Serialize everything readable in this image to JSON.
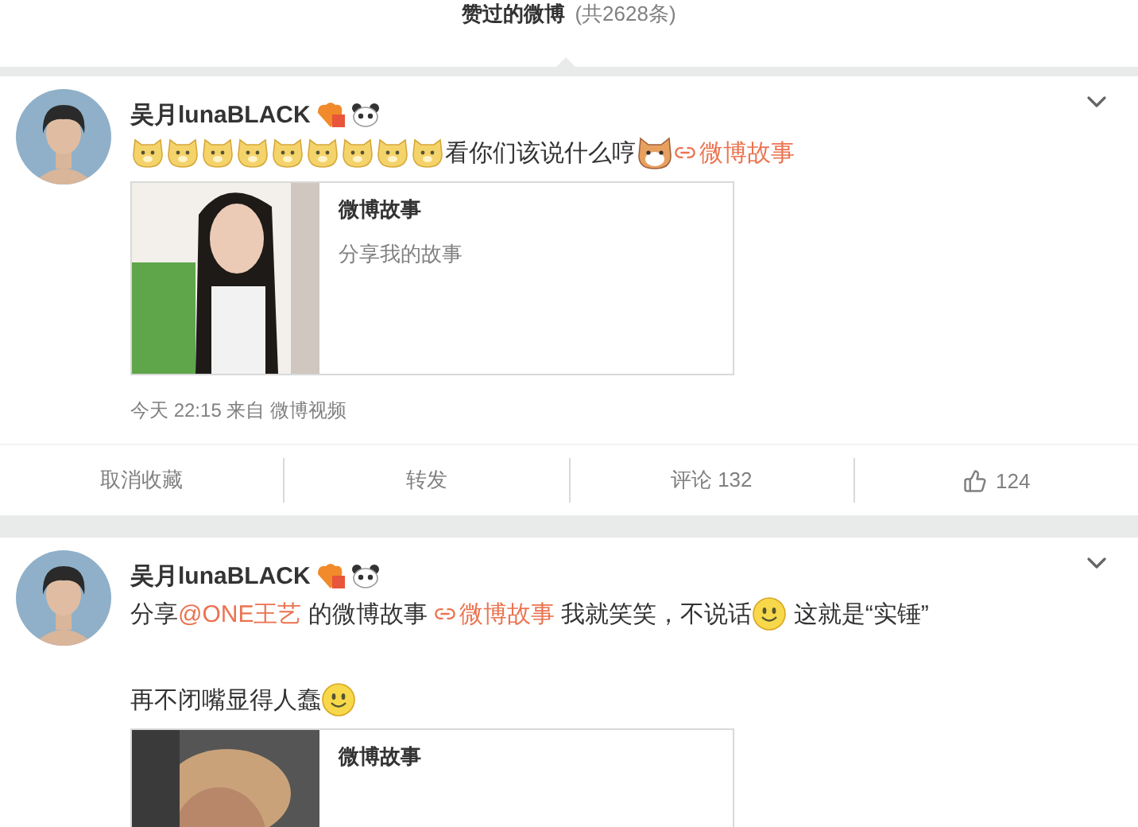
{
  "header": {
    "title": "赞过的微博",
    "count": "(共2628条)"
  },
  "posts": [
    {
      "name": "吴月lunaBLACK",
      "lines": [
        [
          {
            "kind": "dog"
          },
          {
            "kind": "dog"
          },
          {
            "kind": "dog"
          },
          {
            "kind": "dog"
          },
          {
            "kind": "dog"
          },
          {
            "kind": "dog"
          },
          {
            "kind": "dog"
          },
          {
            "kind": "dog"
          },
          {
            "kind": "dog"
          },
          {
            "kind": "text",
            "text": "看你们该说什么哼"
          },
          {
            "kind": "cat"
          },
          {
            "kind": "link",
            "text": "微博故事"
          }
        ]
      ],
      "card": {
        "title": "微博故事",
        "subtitle": "分享我的故事"
      },
      "meta": "今天 22:15 来自 微博视频",
      "actions": [
        {
          "kind": "text",
          "label": "取消收藏"
        },
        {
          "kind": "text",
          "label": "转发"
        },
        {
          "kind": "text",
          "label": "评论 132"
        },
        {
          "kind": "like",
          "label": "124"
        }
      ]
    },
    {
      "name": "吴月lunaBLACK",
      "lines": [
        [
          {
            "kind": "text",
            "text": "分享"
          },
          {
            "kind": "mention",
            "text": "@ONE王艺"
          },
          {
            "kind": "text",
            "text": " 的微博故事 "
          },
          {
            "kind": "link",
            "text": "微博故事"
          },
          {
            "kind": "text",
            "text": " 我就笑笑，不说话"
          },
          {
            "kind": "smile"
          },
          {
            "kind": "text",
            "text": " 这就是“实锤”"
          }
        ],
        [
          {
            "kind": "text",
            "text": "再不闭嘴显得人蠢"
          },
          {
            "kind": "smile"
          }
        ]
      ],
      "card": {
        "title": "微博故事"
      }
    }
  ]
}
